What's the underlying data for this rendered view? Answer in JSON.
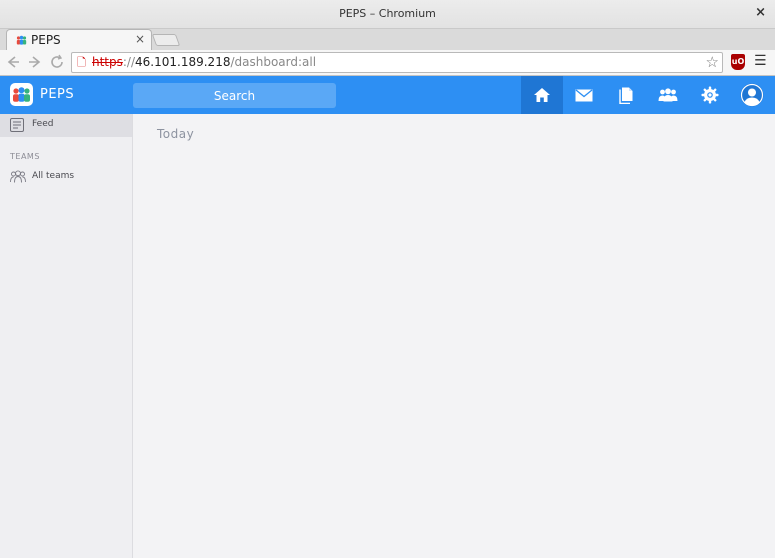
{
  "window": {
    "title": "PEPS – Chromium",
    "close_label": "×"
  },
  "tab": {
    "label": "PEPS",
    "close_label": "×"
  },
  "addressbar": {
    "scheme": "https",
    "separator": "://",
    "host": "46.101.189.218",
    "path": "/dashboard:all",
    "security": "insecure"
  },
  "app": {
    "brand": "PEPS",
    "search_placeholder": "Search",
    "nav": [
      {
        "id": "home",
        "icon": "home-icon",
        "active": true
      },
      {
        "id": "mail",
        "icon": "mail-icon",
        "active": false
      },
      {
        "id": "files",
        "icon": "file-icon",
        "active": false
      },
      {
        "id": "contacts",
        "icon": "people-icon",
        "active": false
      },
      {
        "id": "settings",
        "icon": "gear-icon",
        "active": false
      },
      {
        "id": "profile",
        "icon": "avatar-icon",
        "active": false
      }
    ],
    "accent_color": "#2d8ff3"
  },
  "sidebar": {
    "feed_label": "Feed",
    "teams_heading": "TEAMS",
    "all_teams_label": "All teams"
  },
  "main": {
    "heading": "Today"
  }
}
